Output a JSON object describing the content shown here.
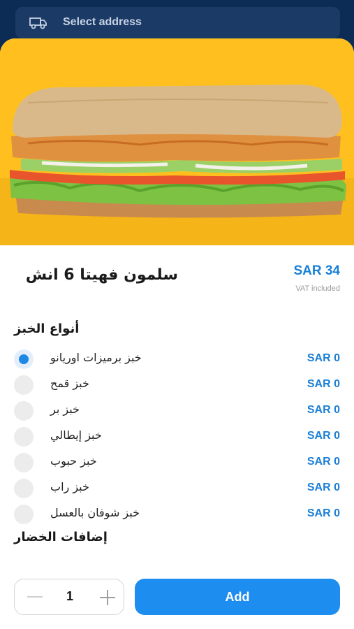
{
  "address_bar": {
    "label": "Select address",
    "icon": "truck-icon"
  },
  "product": {
    "title": "سلمون فهيتا 6 انش",
    "price": "SAR 34",
    "vat_note": "VAT included"
  },
  "bread_section": {
    "title": "أنواع الخبز",
    "options": [
      {
        "label": "خبز برميزات اوريانو",
        "price": "SAR 0",
        "selected": true
      },
      {
        "label": "خبز قمح",
        "price": "SAR 0",
        "selected": false
      },
      {
        "label": "خبز بر",
        "price": "SAR 0",
        "selected": false
      },
      {
        "label": "خبز إيطالي",
        "price": "SAR 0",
        "selected": false
      },
      {
        "label": "خبز حبوب",
        "price": "SAR 0",
        "selected": false
      },
      {
        "label": "خبز راب",
        "price": "SAR 0",
        "selected": false
      },
      {
        "label": "خبز شوفان بالعسل",
        "price": "SAR 0",
        "selected": false
      }
    ]
  },
  "veg_section": {
    "title": "إضافات الخضار"
  },
  "footer": {
    "quantity": "1",
    "add_label": "Add"
  },
  "colors": {
    "accent": "#1e8df0",
    "price": "#1a7fd6",
    "hero_bg": "#ffc01f",
    "header_bg": "#0c2b55"
  }
}
